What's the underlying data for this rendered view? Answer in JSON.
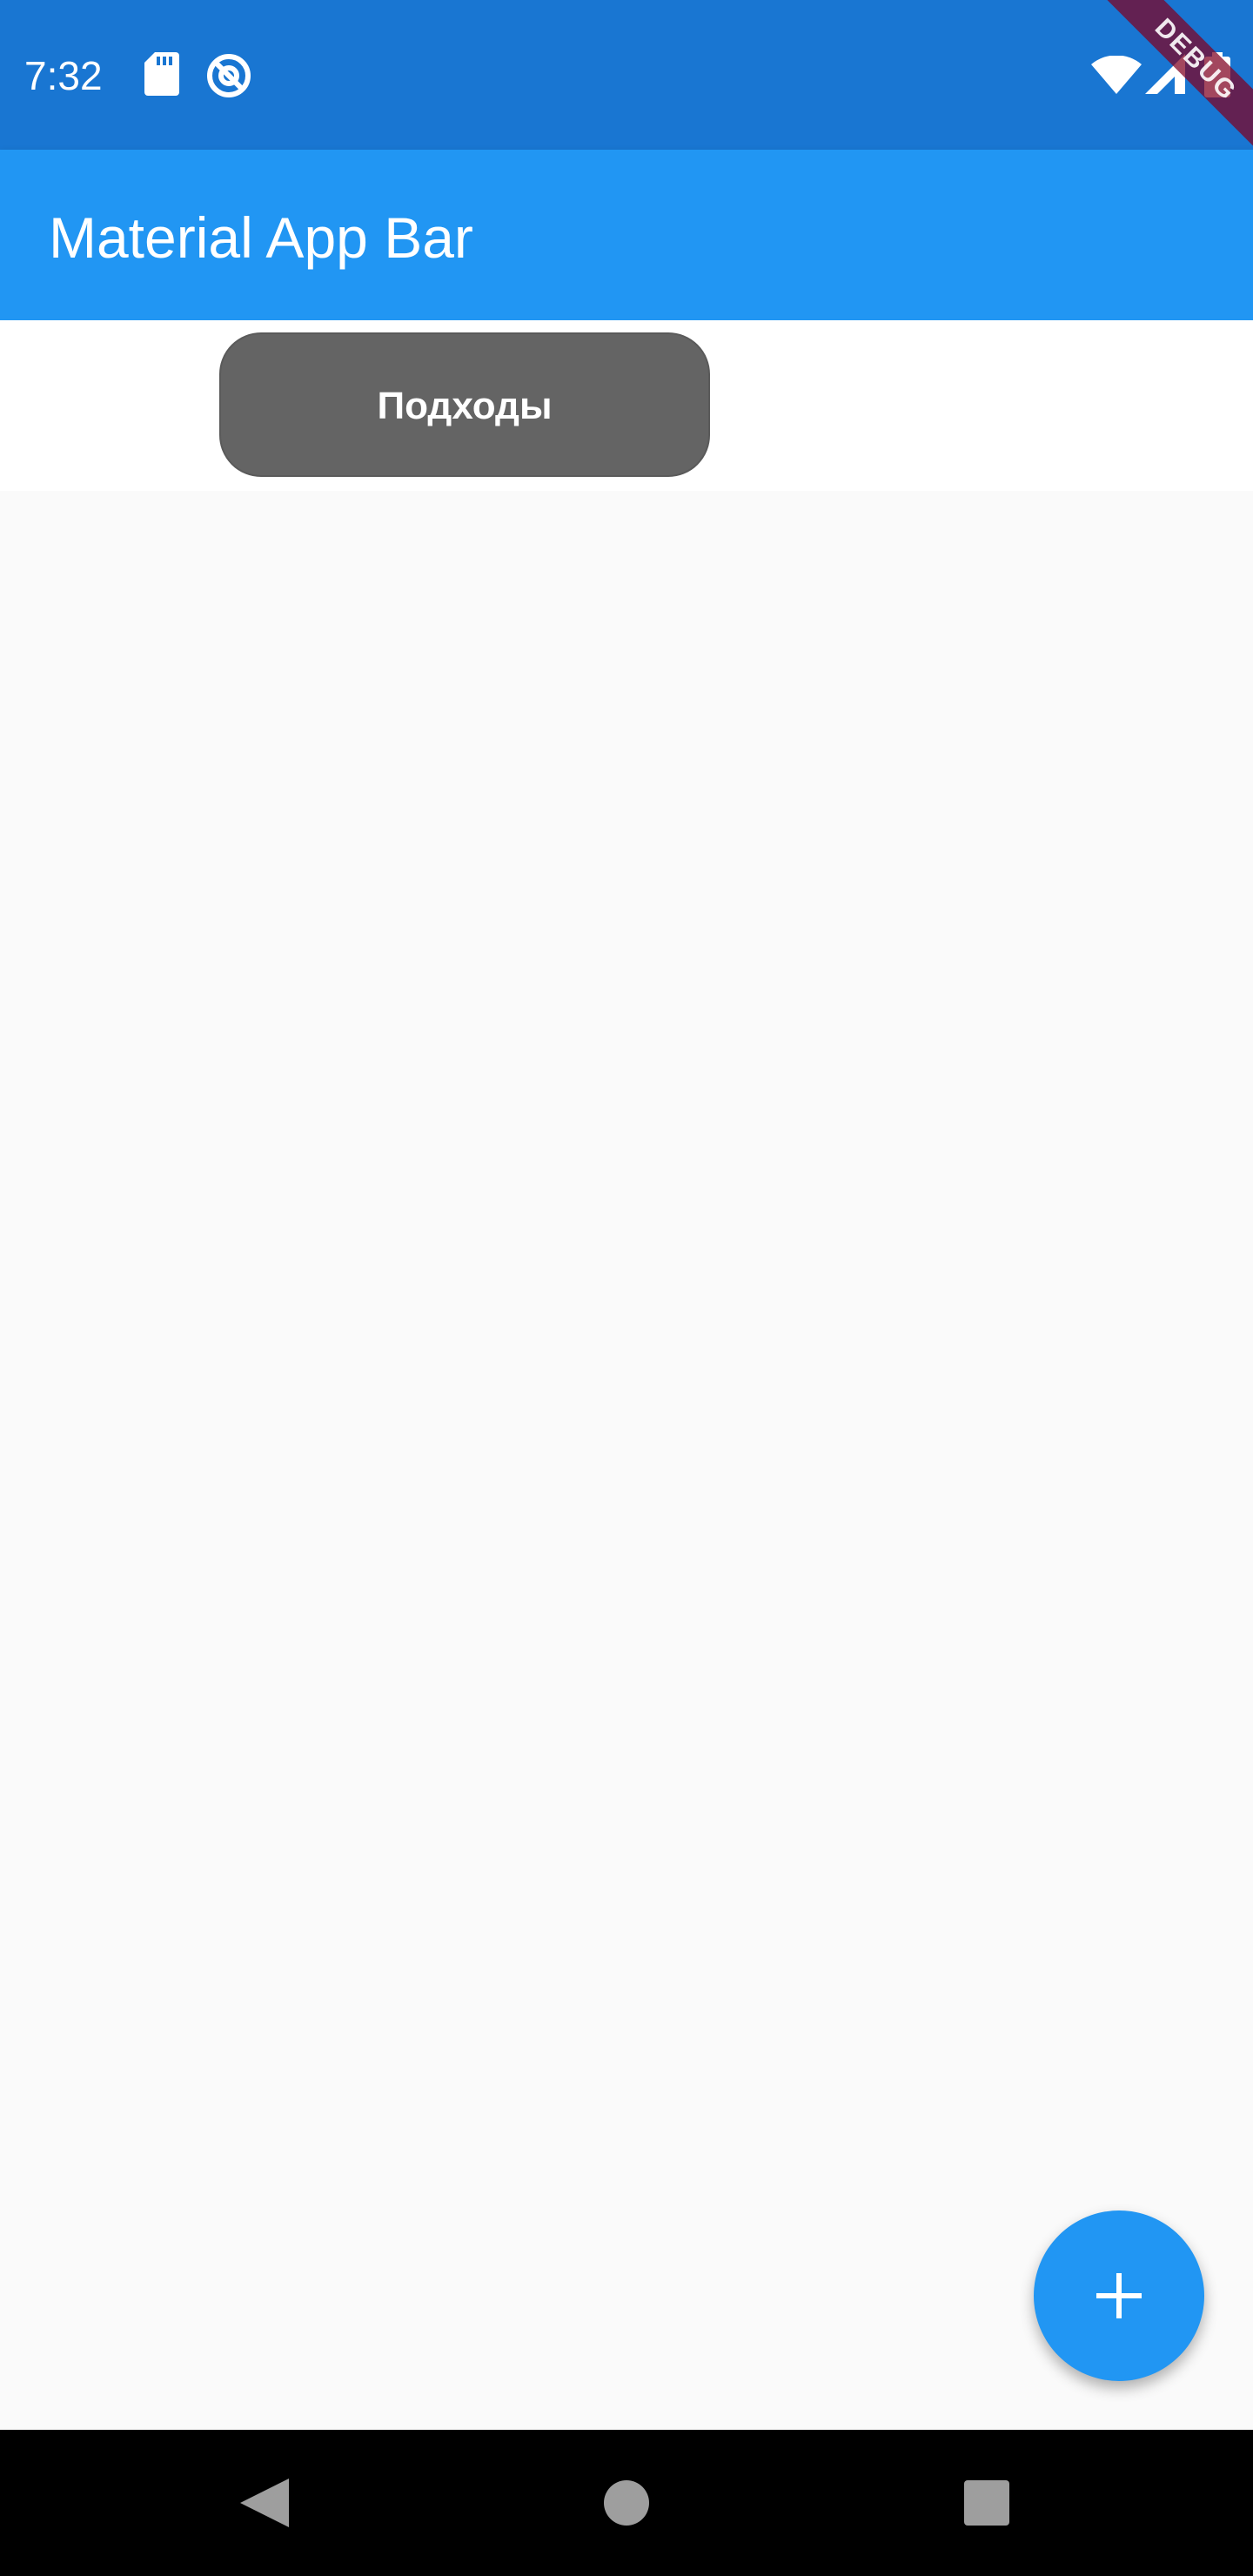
{
  "status_bar": {
    "time": "7:32",
    "left_icons": [
      "sd-card-icon",
      "do-not-disturb-icon"
    ],
    "right_icons": [
      "wifi-icon",
      "cellular-signal-icon",
      "battery-icon"
    ],
    "color": "#1976d2"
  },
  "debug_banner": {
    "label": "DEBUG",
    "color": "#800020"
  },
  "app_bar": {
    "title": "Material App Bar",
    "color": "#2196f3"
  },
  "content": {
    "approaches_button_label": "Подходы",
    "button_color": "#646464",
    "background": "#fafafa"
  },
  "fab": {
    "icon": "plus-icon",
    "color": "#2196f3"
  },
  "nav_bar": {
    "buttons": [
      "back-icon",
      "home-icon",
      "recents-icon"
    ],
    "color": "#000000"
  }
}
